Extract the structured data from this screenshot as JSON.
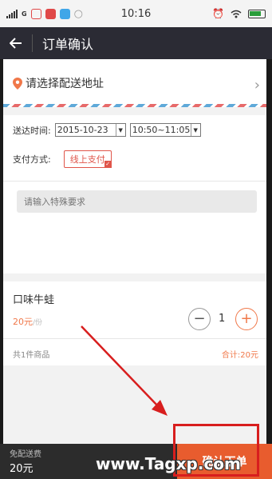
{
  "status_bar": {
    "network": "G",
    "time": "10:16"
  },
  "header": {
    "title": "订单确认"
  },
  "address": {
    "placeholder": "请选择配送地址"
  },
  "delivery": {
    "label": "送达时间:",
    "date": "2015-10-23",
    "time_slot": "10:50~11:05"
  },
  "payment": {
    "label": "支付方式:",
    "selected": "线上支付"
  },
  "remark": {
    "placeholder": "请输入特殊要求"
  },
  "item": {
    "name": "口味牛蛙",
    "price": "20元",
    "unit": "/份",
    "quantity": "1"
  },
  "summary": {
    "count": "共1件商品",
    "total": "合计:20元"
  },
  "bottom": {
    "free_shipping": "免配送费",
    "price": "20元",
    "checkout_label": "确认下单"
  },
  "watermark": "www.Tagxp.com",
  "colors": {
    "accent": "#e85c2e",
    "header_bg": "#2b2b34",
    "annotation": "#d81e1e"
  }
}
